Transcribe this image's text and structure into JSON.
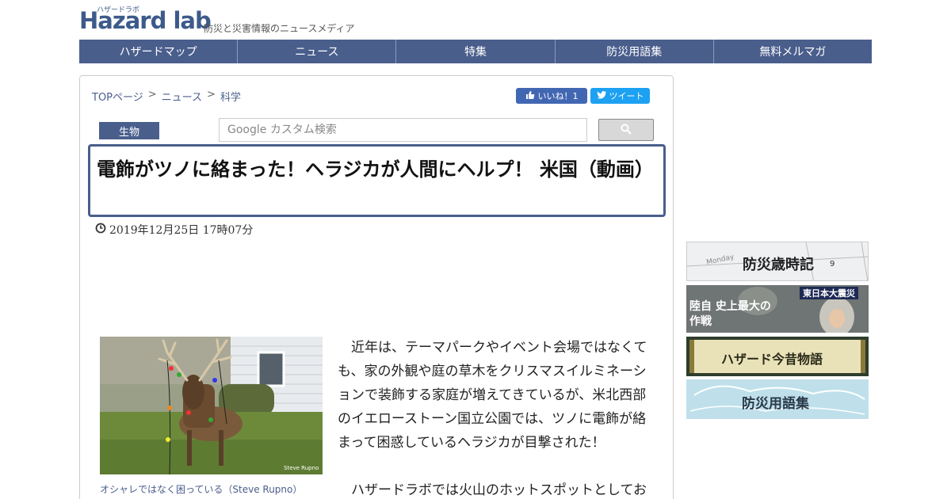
{
  "header": {
    "logo_text": "Hazard lab",
    "logo_kana": "ハザードラボ",
    "tagline": "防災と災害情報のニュースメディア"
  },
  "nav": {
    "items": [
      {
        "label": "ハザードマップ"
      },
      {
        "label": "ニュース"
      },
      {
        "label": "特集"
      },
      {
        "label": "防災用語集"
      },
      {
        "label": "無料メルマガ"
      }
    ]
  },
  "breadcrumb": {
    "items": [
      "TOPページ",
      "ニュース",
      "科学"
    ],
    "separator": ">"
  },
  "social": {
    "fb_label": "いいね！1",
    "tw_label": "ツイート"
  },
  "category": "生物",
  "search": {
    "placeholder": "Google カスタム検索"
  },
  "article": {
    "title": "電飾がツノに絡まった！ヘラジカが人間にヘルプ！ 米国（動画）",
    "date": "2019年12月25日 17時07分",
    "photo_caption": "オシャレではなく困っている（Steve Rupno）",
    "photo_credit": "Steve Rupno",
    "paragraph1": "近年は、テーマパークやイベント会場ではなくても、家の外観や庭の草木をクリスマスイルミネーションで装飾する家庭が増えてきているが、米北西部のイエローストーン国立公園では、ツノに電飾が絡まって困惑しているヘラジカが目撃された！",
    "paragraph2": "ハザードラボでは火山のホットスポットとしてお"
  },
  "sidebar": {
    "banners": [
      {
        "label": "防災歳時記",
        "sub": "Monday"
      },
      {
        "label": "陸自 史上最大の作戦",
        "tag": "東日本大震災"
      },
      {
        "label": "ハザード今昔物語"
      },
      {
        "label": "防災用語集"
      }
    ]
  },
  "colors": {
    "nav_bg": "#4a5e8c",
    "accent": "#3d5a8a",
    "fb": "#4267b2",
    "tw": "#1da1f2"
  }
}
